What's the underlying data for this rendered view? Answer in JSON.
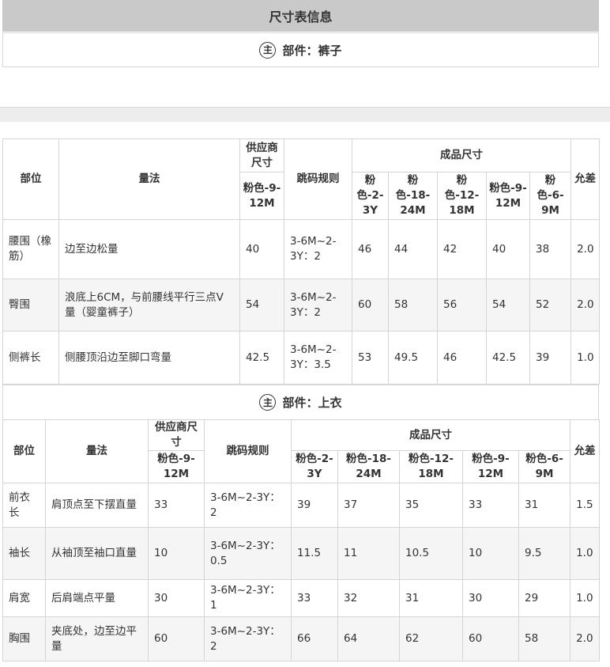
{
  "page_title": "尺寸表信息",
  "part_marker": "主",
  "sections": [
    {
      "part_label": "部件：裤子",
      "headers": {
        "position": "部位",
        "method": "量法",
        "supplier_size": "供应商尺寸",
        "supplier_col": "粉色-9-12M",
        "jump_rule": "跳码规则",
        "finished_size": "成品尺寸",
        "sizes": [
          "粉色-2-3Y",
          "粉色-18-24M",
          "粉色-12-18M",
          "粉色-9-12M",
          "粉色-6-9M"
        ],
        "tolerance": "允差"
      },
      "rows": [
        {
          "position": "腰围（橡筋）",
          "method": "边至边松量",
          "supplier": "40",
          "rule": "3-6M~2-3Y：2",
          "values": [
            "46",
            "44",
            "42",
            "40",
            "38"
          ],
          "tolerance": "2.0"
        },
        {
          "position": "臀围",
          "method": "浪底上6CM，与前腰线平行三点V量（婴童裤子）",
          "supplier": "54",
          "rule": "3-6M~2-3Y：2",
          "values": [
            "60",
            "58",
            "56",
            "54",
            "52"
          ],
          "tolerance": "2.0"
        },
        {
          "position": "侧裤长",
          "method": "侧腰顶沿边至脚口弯量",
          "supplier": "42.5",
          "rule": "3-6M~2-3Y：3.5",
          "values": [
            "53",
            "49.5",
            "46",
            "42.5",
            "39"
          ],
          "tolerance": "1.0"
        }
      ]
    },
    {
      "part_label": "部件：上衣",
      "headers": {
        "position": "部位",
        "method": "量法",
        "supplier_size": "供应商尺寸",
        "supplier_col": "粉色-9-12M",
        "jump_rule": "跳码规则",
        "finished_size": "成品尺寸",
        "sizes": [
          "粉色-2-3Y",
          "粉色-18-24M",
          "粉色-12-18M",
          "粉色-9-12M",
          "粉色-6-9M"
        ],
        "tolerance": "允差"
      },
      "rows": [
        {
          "position": "前衣长",
          "method": "肩顶点至下摆直量",
          "supplier": "33",
          "rule": "3-6M~2-3Y：2",
          "values": [
            "39",
            "37",
            "35",
            "33",
            "31"
          ],
          "tolerance": "1.5"
        },
        {
          "position": "袖长",
          "method": "从袖顶至袖口直量",
          "supplier": "10",
          "rule": "3-6M~2-3Y：0.5",
          "values": [
            "11.5",
            "11",
            "10.5",
            "10",
            "9.5"
          ],
          "tolerance": "1.0"
        },
        {
          "position": "肩宽",
          "method": "后肩端点平量",
          "supplier": "30",
          "rule": "3-6M~2-3Y：1",
          "values": [
            "33",
            "32",
            "31",
            "30",
            "29"
          ],
          "tolerance": "1.0"
        },
        {
          "position": "胸围",
          "method": "夹底处，边至边平量",
          "supplier": "60",
          "rule": "3-6M~2-3Y：2",
          "values": [
            "66",
            "64",
            "62",
            "60",
            "58"
          ],
          "tolerance": "2.0"
        }
      ]
    }
  ]
}
